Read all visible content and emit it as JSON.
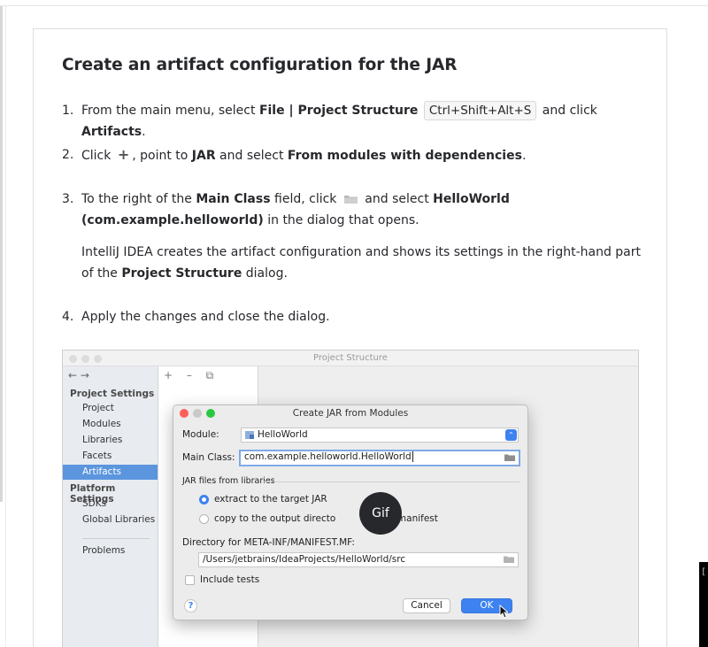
{
  "heading": "Create an artifact configuration for the JAR",
  "steps": [
    {
      "num": "1.",
      "pre": "From the main menu, select ",
      "b1": "File | Project Structure",
      "shortcut": "Ctrl+Shift+Alt+S",
      "mid": " and click ",
      "b2": "Artifacts",
      "post": "."
    },
    {
      "num": "2.",
      "pre": "Click ",
      "plus": "+",
      "mid": ", point to ",
      "b1": "JAR",
      "mid2": " and select ",
      "b2": "From modules with dependencies",
      "post": "."
    },
    {
      "num": "3.",
      "pre": "To the right of the ",
      "b1": "Main Class",
      "mid": " field, click ",
      "mid2": " and select ",
      "b2": "HelloWorld (com.example.helloworld)",
      "post": " in the dialog that opens.",
      "para_pre": "IntelliJ IDEA creates the artifact configuration and shows its settings in the right-hand part of the ",
      "para_b": "Project Structure",
      "para_post": " dialog."
    },
    {
      "num": "4.",
      "text": "Apply the changes and close the dialog."
    }
  ],
  "screenshot": {
    "window_title": "Project Structure",
    "nav_arrows": "← →",
    "mid_tools": "+ – ⧉",
    "sidebar": {
      "project_settings": "Project Settings",
      "items": [
        "Project",
        "Modules",
        "Libraries",
        "Facets",
        "Artifacts"
      ],
      "platform_settings": "Platform Settings",
      "platform_items": [
        "SDKs",
        "Global Libraries"
      ],
      "problems": "Problems"
    },
    "dialog": {
      "title": "Create JAR from Modules",
      "module_label": "Module:",
      "module_value": "HelloWorld",
      "main_class_label": "Main Class:",
      "main_class_value": "com.example.helloworld.HelloWorld",
      "jar_files_label": "JAR files from libraries",
      "option_extract": "extract to the target JAR",
      "option_copy_pre": "copy to the output directo",
      "option_copy_post": "via manifest",
      "manifest_label": "Directory for META-INF/MANIFEST.MF:",
      "manifest_value": "/Users/jetbrains/IdeaProjects/HelloWorld/src",
      "include_tests": "Include tests",
      "help": "?",
      "cancel": "Cancel",
      "ok": "OK"
    },
    "gif_badge": "Gif"
  },
  "overlay_bracket": "[",
  "colors": {
    "accent_blue": "#3d82f0",
    "selection_blue": "#5b95de",
    "text": "#27282c"
  },
  "icons": [
    "plus-icon",
    "folder-icon",
    "module-icon",
    "chevron-icon",
    "help-icon",
    "cursor-icon"
  ]
}
